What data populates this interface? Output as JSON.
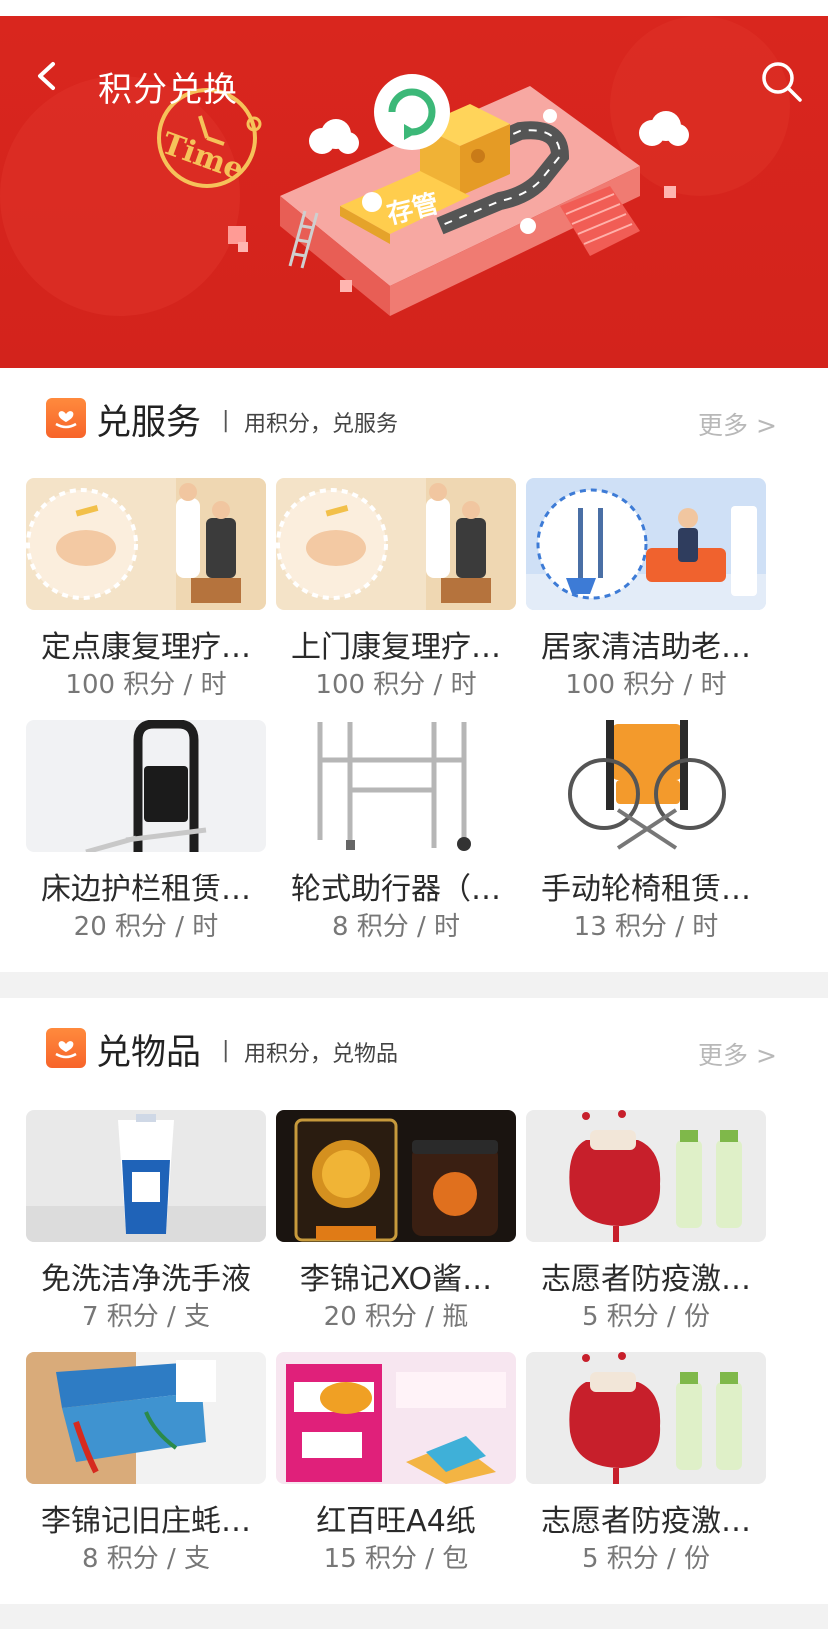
{
  "header": {
    "title": "积分兑换",
    "banner_tags": {
      "time": "Time",
      "savings": "存管"
    }
  },
  "services": {
    "title": "兑服务",
    "separator": "|",
    "subtitle": "用积分，兑服务",
    "more": "更多 >",
    "items": [
      {
        "name": "定点康复理疗…",
        "price": "100 积分 / 时",
        "image": "rehab-therapy-illustration"
      },
      {
        "name": "上门康复理疗…",
        "price": "100 积分 / 时",
        "image": "rehab-therapy-illustration"
      },
      {
        "name": "居家清洁助老…",
        "price": "100 积分 / 时",
        "image": "home-cleaning-illustration"
      },
      {
        "name": "床边护栏租赁…",
        "price": "20 积分 / 时",
        "image": "bedside-rail-photo"
      },
      {
        "name": "轮式助行器（…",
        "price": "8 积分 / 时",
        "image": "wheeled-walker-photo"
      },
      {
        "name": "手动轮椅租赁…",
        "price": "13 积分 / 时",
        "image": "manual-wheelchair-photo"
      }
    ]
  },
  "goods": {
    "title": "兑物品",
    "separator": "|",
    "subtitle": "用积分，兑物品",
    "more": "更多 >",
    "items": [
      {
        "name": "免洗洁净洗手液",
        "price": "7 积分 / 支",
        "image": "hand-sanitizer-photo"
      },
      {
        "name": "李锦记XO酱…",
        "price": "20 积分 / 瓶",
        "image": "xo-sauce-photo"
      },
      {
        "name": "志愿者防疫激…",
        "price": "5 积分 / 份",
        "image": "sachet-sanitizer-photo"
      },
      {
        "name": "李锦记旧庄蚝…",
        "price": "8 积分 / 支",
        "image": "oyster-sauce-tube-photo"
      },
      {
        "name": "红百旺A4纸",
        "price": "15 积分 / 包",
        "image": "a4-paper-photo"
      },
      {
        "name": "志愿者防疫激…",
        "price": "5 积分 / 份",
        "image": "sachet-sanitizer-photo"
      }
    ]
  },
  "colors": {
    "banner_red": "#d9261e",
    "section_icon_orange": "#f7642a",
    "more_gray": "#b8b8b8",
    "gap_gray": "#f2f2f2"
  }
}
